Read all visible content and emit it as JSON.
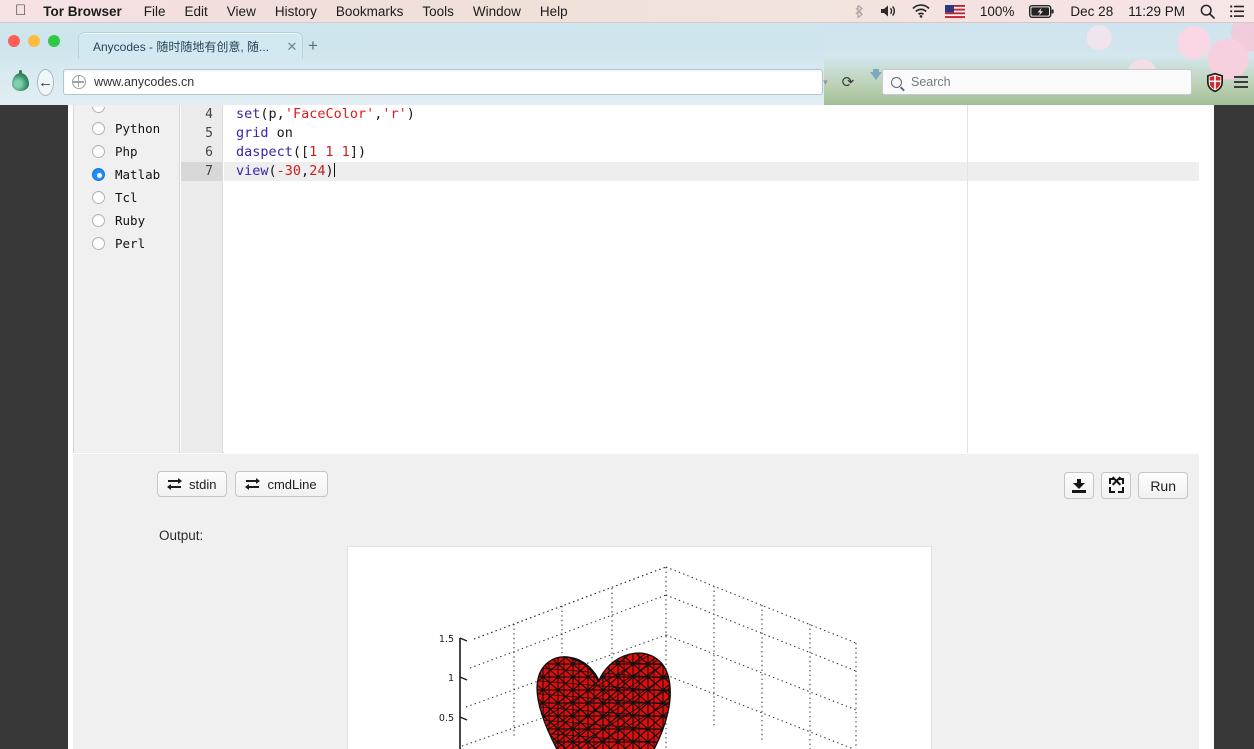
{
  "menubar": {
    "apple_icon": "apple-logo-icon",
    "items": [
      {
        "label": "Tor Browser",
        "bold": true
      },
      {
        "label": "File",
        "bold": false
      },
      {
        "label": "Edit",
        "bold": false
      },
      {
        "label": "View",
        "bold": false
      },
      {
        "label": "History",
        "bold": false
      },
      {
        "label": "Bookmarks",
        "bold": false
      },
      {
        "label": "Tools",
        "bold": false
      },
      {
        "label": "Window",
        "bold": false
      },
      {
        "label": "Help",
        "bold": false
      }
    ],
    "status": {
      "bluetooth_icon": "bluetooth-icon",
      "volume_icon": "volume-icon",
      "wifi_icon": "wifi-icon",
      "flag_icon": "us-flag-icon",
      "battery_percent": "100%",
      "battery_icon": "battery-charging-icon",
      "date": "Dec 28",
      "time": "11:29 PM",
      "search_icon": "spotlight-search-icon",
      "menu_icon": "notification-center-icon"
    }
  },
  "browser": {
    "window_controls": [
      "close",
      "minimize",
      "zoom"
    ],
    "tab": {
      "title": "Anycodes - 随时随地有创意, 随...",
      "close_label": "✕"
    },
    "new_tab_label": "+",
    "onion_icon": "tor-onion-icon",
    "back_label": "←",
    "url": "www.anycodes.cn",
    "url_dropdown_label": "▾",
    "reload_label": "⟳",
    "download_icon": "download-arrow-icon",
    "search": {
      "placeholder": "Search",
      "icon": "search-icon"
    },
    "noscript_icon": "noscript-shield-icon",
    "menu_icon": "hamburger-menu-icon"
  },
  "languages": {
    "options": [
      {
        "label": "",
        "selected": false,
        "clipped": true
      },
      {
        "label": "Python",
        "selected": false
      },
      {
        "label": "Php",
        "selected": false
      },
      {
        "label": "Matlab",
        "selected": true
      },
      {
        "label": "Tcl",
        "selected": false
      },
      {
        "label": "Ruby",
        "selected": false
      },
      {
        "label": "Perl",
        "selected": false
      }
    ]
  },
  "editor": {
    "line_numbers": [
      "4",
      "5",
      "6",
      "7"
    ],
    "active_line": "7",
    "lines": [
      {
        "number": "4",
        "text": "set(p,'FaceColor','r')"
      },
      {
        "number": "5",
        "text": "grid on"
      },
      {
        "number": "6",
        "text": "daspect([1 1 1])"
      },
      {
        "number": "7",
        "text": "view(-30,24)"
      }
    ]
  },
  "toolbar": {
    "stdin_label": "stdin",
    "cmdline_label": "cmdLine",
    "download_label": "download-icon",
    "fullscreen_label": "fullscreen-icon",
    "run_label": "Run"
  },
  "output": {
    "label": "Output:"
  },
  "chart_data": {
    "type": "surface",
    "title": "",
    "renderer": "matlab-3d-surface",
    "description": "3D heart-shaped implicit surface rendered as a red triangulated mesh with black edges inside a dotted 3D grid box",
    "surface_color": "#e10d0d",
    "edge_color": "#111111",
    "grid": true,
    "grid_style": "dotted",
    "view": {
      "azimuth": -30,
      "elevation": 24
    },
    "daspect": [
      1,
      1,
      1
    ],
    "zaxis": {
      "ticks": [
        1.5,
        1,
        0.5
      ],
      "tick_labels": [
        "1.5",
        "1",
        "0.5"
      ],
      "visible_range": [
        0.3,
        1.6
      ]
    },
    "xlabel": "",
    "ylabel": "",
    "zlabel": ""
  }
}
